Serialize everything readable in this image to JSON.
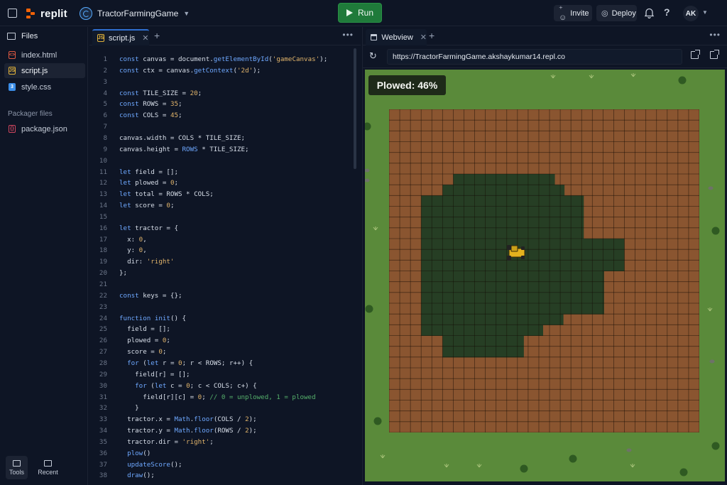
{
  "app": {
    "brand": "replit",
    "project_name": "TractorFarmingGame",
    "run_label": "Run",
    "invite_label": "Invite",
    "deploy_label": "Deploy",
    "help_label": "?",
    "user_initials": "AK",
    "accent_color": "#f26207",
    "run_color": "#1f7a3a"
  },
  "sidebar": {
    "files_title": "Files",
    "files": [
      {
        "name": "index.html",
        "icon": "html-file-icon"
      },
      {
        "name": "script.js",
        "icon": "js-file-icon"
      },
      {
        "name": "style.css",
        "icon": "css-file-icon"
      }
    ],
    "packager_title": "Packager files",
    "packager_files": [
      {
        "name": "package.json",
        "icon": "json-file-icon"
      }
    ],
    "tools_label": "Tools",
    "recent_label": "Recent"
  },
  "editor": {
    "tab_label": "script.js",
    "tab_badge": "JS",
    "lines": [
      [
        [
          "kw",
          "const"
        ],
        [
          "t",
          " canvas = document."
        ],
        [
          "fn",
          "getElementById"
        ],
        [
          "t",
          "("
        ],
        [
          "str",
          "'gameCanvas'"
        ],
        [
          "t",
          ");"
        ]
      ],
      [
        [
          "kw",
          "const"
        ],
        [
          "t",
          " ctx = canvas."
        ],
        [
          "fn",
          "getContext"
        ],
        [
          "t",
          "("
        ],
        [
          "str",
          "'2d'"
        ],
        [
          "t",
          ");"
        ]
      ],
      [],
      [
        [
          "kw",
          "const"
        ],
        [
          "t",
          " TILE_SIZE = "
        ],
        [
          "num",
          "20"
        ],
        [
          "t",
          ";"
        ]
      ],
      [
        [
          "kw",
          "const"
        ],
        [
          "t",
          " ROWS = "
        ],
        [
          "num",
          "35"
        ],
        [
          "t",
          ";"
        ]
      ],
      [
        [
          "kw",
          "const"
        ],
        [
          "t",
          " COLS = "
        ],
        [
          "num",
          "45"
        ],
        [
          "t",
          ";"
        ]
      ],
      [],
      [
        [
          "t",
          "canvas.width = COLS * TILE_SIZE;"
        ]
      ],
      [
        [
          "t",
          "canvas.height = "
        ],
        [
          "kw",
          "ROWS"
        ],
        [
          "t",
          " * TILE_SIZE;"
        ]
      ],
      [],
      [
        [
          "kw",
          "let"
        ],
        [
          "t",
          " field = [];"
        ]
      ],
      [
        [
          "kw",
          "let"
        ],
        [
          "t",
          " plowed = "
        ],
        [
          "num",
          "0"
        ],
        [
          "t",
          ";"
        ]
      ],
      [
        [
          "kw",
          "let"
        ],
        [
          "t",
          " total = ROWS * COLS;"
        ]
      ],
      [
        [
          "kw",
          "let"
        ],
        [
          "t",
          " score = "
        ],
        [
          "num",
          "0"
        ],
        [
          "t",
          ";"
        ]
      ],
      [],
      [
        [
          "kw",
          "let"
        ],
        [
          "t",
          " tractor = {"
        ]
      ],
      [
        [
          "t",
          "  x: "
        ],
        [
          "num",
          "0"
        ],
        [
          "t",
          ","
        ]
      ],
      [
        [
          "t",
          "  y: "
        ],
        [
          "num",
          "0"
        ],
        [
          "t",
          ","
        ]
      ],
      [
        [
          "t",
          "  dir: "
        ],
        [
          "str",
          "'right'"
        ]
      ],
      [
        [
          "t",
          "};"
        ]
      ],
      [],
      [
        [
          "kw",
          "const"
        ],
        [
          "t",
          " keys = {};"
        ]
      ],
      [],
      [
        [
          "kw",
          "function"
        ],
        [
          "t",
          " "
        ],
        [
          "fn",
          "init"
        ],
        [
          "t",
          "() {"
        ]
      ],
      [
        [
          "t",
          "  field = [];"
        ]
      ],
      [
        [
          "t",
          "  plowed = "
        ],
        [
          "num",
          "0"
        ],
        [
          "t",
          ";"
        ]
      ],
      [
        [
          "t",
          "  score = "
        ],
        [
          "num",
          "0"
        ],
        [
          "t",
          ";"
        ]
      ],
      [
        [
          "t",
          "  "
        ],
        [
          "kw",
          "for"
        ],
        [
          "t",
          " ("
        ],
        [
          "kw",
          "let"
        ],
        [
          "t",
          " r = "
        ],
        [
          "num",
          "0"
        ],
        [
          "t",
          "; r < ROWS; r++) {"
        ]
      ],
      [
        [
          "t",
          "    field[r] = [];"
        ]
      ],
      [
        [
          "t",
          "    "
        ],
        [
          "kw",
          "for"
        ],
        [
          "t",
          " ("
        ],
        [
          "kw",
          "let"
        ],
        [
          "t",
          " c = "
        ],
        [
          "num",
          "0"
        ],
        [
          "t",
          "; c < COLS; c+) {"
        ]
      ],
      [
        [
          "t",
          "      field[r][c] = "
        ],
        [
          "num",
          "0"
        ],
        [
          "t",
          "; "
        ],
        [
          "cmt",
          "// 0 = unplowed, 1 = plowed"
        ]
      ],
      [
        [
          "t",
          "    }"
        ]
      ],
      [
        [
          "t",
          "  tractor.x = "
        ],
        [
          "kw",
          "Math"
        ],
        [
          "t",
          "."
        ],
        [
          "fn",
          "floor"
        ],
        [
          "t",
          "(COLS / "
        ],
        [
          "num",
          "2"
        ],
        [
          "t",
          ");"
        ]
      ],
      [
        [
          "t",
          "  tractor.y = "
        ],
        [
          "kw",
          "Math"
        ],
        [
          "t",
          "."
        ],
        [
          "fn",
          "floor"
        ],
        [
          "t",
          "(ROWS / "
        ],
        [
          "num",
          "2"
        ],
        [
          "t",
          ");"
        ]
      ],
      [
        [
          "t",
          "  tractor.dir = "
        ],
        [
          "str",
          "'right'"
        ],
        [
          "t",
          ";"
        ]
      ],
      [
        [
          "t",
          "  "
        ],
        [
          "fn",
          "plow"
        ],
        [
          "t",
          "()"
        ]
      ],
      [
        [
          "t",
          "  "
        ],
        [
          "fn",
          "updateScore"
        ],
        [
          "t",
          "();"
        ]
      ],
      [
        [
          "t",
          "  "
        ],
        [
          "fn",
          "draw"
        ],
        [
          "t",
          "();"
        ]
      ],
      [
        [
          "t",
          "}"
        ]
      ]
    ]
  },
  "webview": {
    "tab_label": "Webview",
    "url": "https://TractorFarmingGame.akshaykumar14.repl.co",
    "game": {
      "score_text": "Plowed: 46%",
      "grass_color": "#5a8a3a",
      "dirt_color": "#8a5530",
      "plowed_color": "#263e24",
      "plowed_rows": [
        [],
        [],
        [],
        [],
        [],
        [],
        [
          [
            4,
            8
          ]
        ],
        [
          [
            3,
            8
          ]
        ],
        [
          [
            1,
            8
          ]
        ],
        [
          [
            1,
            8
          ]
        ],
        [
          [
            1,
            8
          ]
        ],
        [
          [
            1,
            8
          ]
        ],
        [
          [
            1,
            10
          ]
        ],
        [
          [
            1,
            10
          ]
        ],
        [
          [
            1,
            10
          ]
        ],
        [
          [
            1,
            9
          ]
        ],
        [
          [
            1,
            9
          ]
        ],
        [
          [
            1,
            9
          ]
        ],
        [
          [
            1,
            9
          ]
        ],
        [
          [
            1,
            7
          ]
        ],
        [
          [
            1,
            6
          ]
        ],
        [
          [
            3,
            6
          ]
        ],
        [
          [
            3,
            6
          ]
        ],
        [],
        [],
        [],
        [],
        [],
        [],
        [],
        []
      ],
      "tractor_icon": "tractor-icon"
    }
  }
}
